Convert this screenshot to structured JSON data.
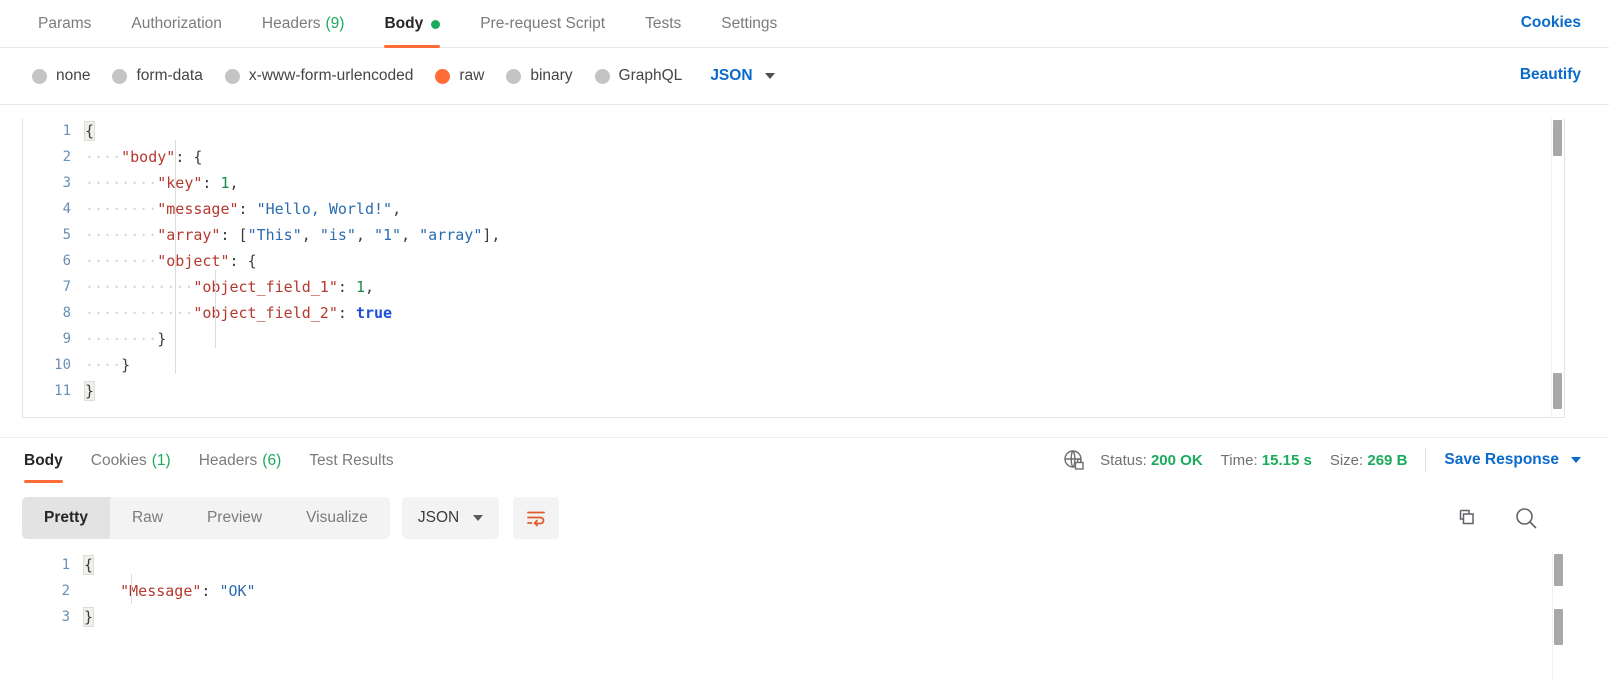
{
  "request_tabs": [
    {
      "label": "Params",
      "count": null,
      "active": false,
      "dot": false
    },
    {
      "label": "Authorization",
      "count": null,
      "active": false,
      "dot": false
    },
    {
      "label": "Headers",
      "count": "(9)",
      "active": false,
      "dot": false
    },
    {
      "label": "Body",
      "count": null,
      "active": true,
      "dot": true
    },
    {
      "label": "Pre-request Script",
      "count": null,
      "active": false,
      "dot": false
    },
    {
      "label": "Tests",
      "count": null,
      "active": false,
      "dot": false
    },
    {
      "label": "Settings",
      "count": null,
      "active": false,
      "dot": false
    }
  ],
  "cookies_link": "Cookies",
  "beautify_link": "Beautify",
  "body_types": [
    {
      "label": "none",
      "selected": false
    },
    {
      "label": "form-data",
      "selected": false
    },
    {
      "label": "x-www-form-urlencoded",
      "selected": false
    },
    {
      "label": "raw",
      "selected": true
    },
    {
      "label": "binary",
      "selected": false
    },
    {
      "label": "GraphQL",
      "selected": false
    }
  ],
  "raw_format": "JSON",
  "request_body": {
    "lines": [
      {
        "num": "1",
        "tokens": [
          {
            "t": "{",
            "c": "p brace-hl"
          }
        ]
      },
      {
        "num": "2",
        "tokens": [
          {
            "t": "····",
            "c": "ind"
          },
          {
            "t": "\"body\"",
            "c": "k"
          },
          {
            "t": ": ",
            "c": "p"
          },
          {
            "t": "{",
            "c": "p"
          }
        ]
      },
      {
        "num": "3",
        "tokens": [
          {
            "t": "········",
            "c": "ind"
          },
          {
            "t": "\"key\"",
            "c": "k"
          },
          {
            "t": ": ",
            "c": "p"
          },
          {
            "t": "1",
            "c": "n"
          },
          {
            "t": ",",
            "c": "p"
          }
        ]
      },
      {
        "num": "4",
        "tokens": [
          {
            "t": "········",
            "c": "ind"
          },
          {
            "t": "\"message\"",
            "c": "k"
          },
          {
            "t": ": ",
            "c": "p"
          },
          {
            "t": "\"Hello, World!\"",
            "c": "s"
          },
          {
            "t": ",",
            "c": "p"
          }
        ]
      },
      {
        "num": "5",
        "tokens": [
          {
            "t": "········",
            "c": "ind"
          },
          {
            "t": "\"array\"",
            "c": "k"
          },
          {
            "t": ": [",
            "c": "p"
          },
          {
            "t": "\"This\"",
            "c": "s"
          },
          {
            "t": ", ",
            "c": "p"
          },
          {
            "t": "\"is\"",
            "c": "s"
          },
          {
            "t": ", ",
            "c": "p"
          },
          {
            "t": "\"1\"",
            "c": "s"
          },
          {
            "t": ", ",
            "c": "p"
          },
          {
            "t": "\"array\"",
            "c": "s"
          },
          {
            "t": "],",
            "c": "p"
          }
        ]
      },
      {
        "num": "6",
        "tokens": [
          {
            "t": "········",
            "c": "ind"
          },
          {
            "t": "\"object\"",
            "c": "k"
          },
          {
            "t": ": ",
            "c": "p"
          },
          {
            "t": "{",
            "c": "p"
          }
        ]
      },
      {
        "num": "7",
        "tokens": [
          {
            "t": "············",
            "c": "ind"
          },
          {
            "t": "\"object_field_1\"",
            "c": "k"
          },
          {
            "t": ": ",
            "c": "p"
          },
          {
            "t": "1",
            "c": "n"
          },
          {
            "t": ",",
            "c": "p"
          }
        ]
      },
      {
        "num": "8",
        "tokens": [
          {
            "t": "············",
            "c": "ind"
          },
          {
            "t": "\"object_field_2\"",
            "c": "k"
          },
          {
            "t": ": ",
            "c": "p"
          },
          {
            "t": "true",
            "c": "b"
          }
        ]
      },
      {
        "num": "9",
        "tokens": [
          {
            "t": "········",
            "c": "ind"
          },
          {
            "t": "}",
            "c": "p"
          }
        ]
      },
      {
        "num": "10",
        "tokens": [
          {
            "t": "····",
            "c": "ind"
          },
          {
            "t": "}",
            "c": "p"
          }
        ]
      },
      {
        "num": "11",
        "tokens": [
          {
            "t": "}",
            "c": "p brace-hl"
          }
        ]
      }
    ]
  },
  "response_tabs": [
    {
      "label": "Body",
      "count": null,
      "active": true
    },
    {
      "label": "Cookies",
      "count": "(1)",
      "active": false
    },
    {
      "label": "Headers",
      "count": "(6)",
      "active": false
    },
    {
      "label": "Test Results",
      "count": null,
      "active": false
    }
  ],
  "response_meta": {
    "status_label": "Status:",
    "status_value": "200 OK",
    "time_label": "Time:",
    "time_value": "15.15 s",
    "size_label": "Size:",
    "size_value": "269 B",
    "save_response": "Save Response"
  },
  "response_toolbar": {
    "segments": [
      {
        "label": "Pretty",
        "active": true
      },
      {
        "label": "Raw",
        "active": false
      },
      {
        "label": "Preview",
        "active": false
      },
      {
        "label": "Visualize",
        "active": false
      }
    ],
    "format": "JSON"
  },
  "response_body": {
    "lines": [
      {
        "num": "1",
        "tokens": [
          {
            "t": "{",
            "c": "p brace-hl"
          }
        ]
      },
      {
        "num": "2",
        "tokens": [
          {
            "t": "    ",
            "c": "ind"
          },
          {
            "t": "\"Message\"",
            "c": "k"
          },
          {
            "t": ": ",
            "c": "p"
          },
          {
            "t": "\"OK\"",
            "c": "s"
          }
        ]
      },
      {
        "num": "3",
        "tokens": [
          {
            "t": "}",
            "c": "p brace-hl"
          }
        ]
      }
    ]
  },
  "colors": {
    "accent": "#ff6c37",
    "link": "#0b6bcb",
    "success": "#1bab5c",
    "json_key": "#b5392f",
    "json_string": "#2b6cb0",
    "json_number": "#1a8a4a",
    "json_boolean": "#1d4fd8"
  }
}
